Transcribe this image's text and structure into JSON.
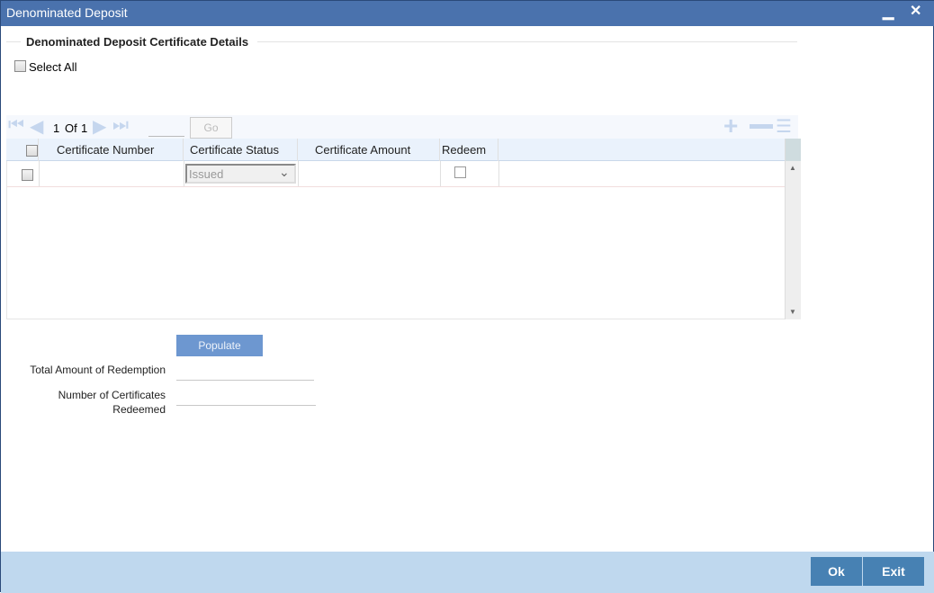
{
  "window": {
    "title": "Denominated Deposit",
    "minimize": "▁",
    "close": "✕"
  },
  "section": {
    "title": "Denominated Deposit Certificate Details"
  },
  "select_all": {
    "label": "Select All",
    "checked": false
  },
  "pager": {
    "current": "1",
    "of_label": "Of",
    "total": "1",
    "go_label": "Go",
    "page_input": ""
  },
  "grid": {
    "columns": [
      "Certificate Number",
      "Certificate Status",
      "Certificate Amount",
      "Redeem"
    ],
    "rows": [
      {
        "certificate_number": "",
        "status": "Issued",
        "amount": "",
        "redeem": false
      }
    ]
  },
  "populate_label": "Populate",
  "fields": {
    "total_amount_label": "Total Amount of Redemption",
    "total_amount_value": "",
    "num_certs_label_1": "Number of Certificates",
    "num_certs_label_2": "Redeemed",
    "num_certs_value": ""
  },
  "footer": {
    "ok_label": "Ok",
    "exit_label": "Exit"
  }
}
